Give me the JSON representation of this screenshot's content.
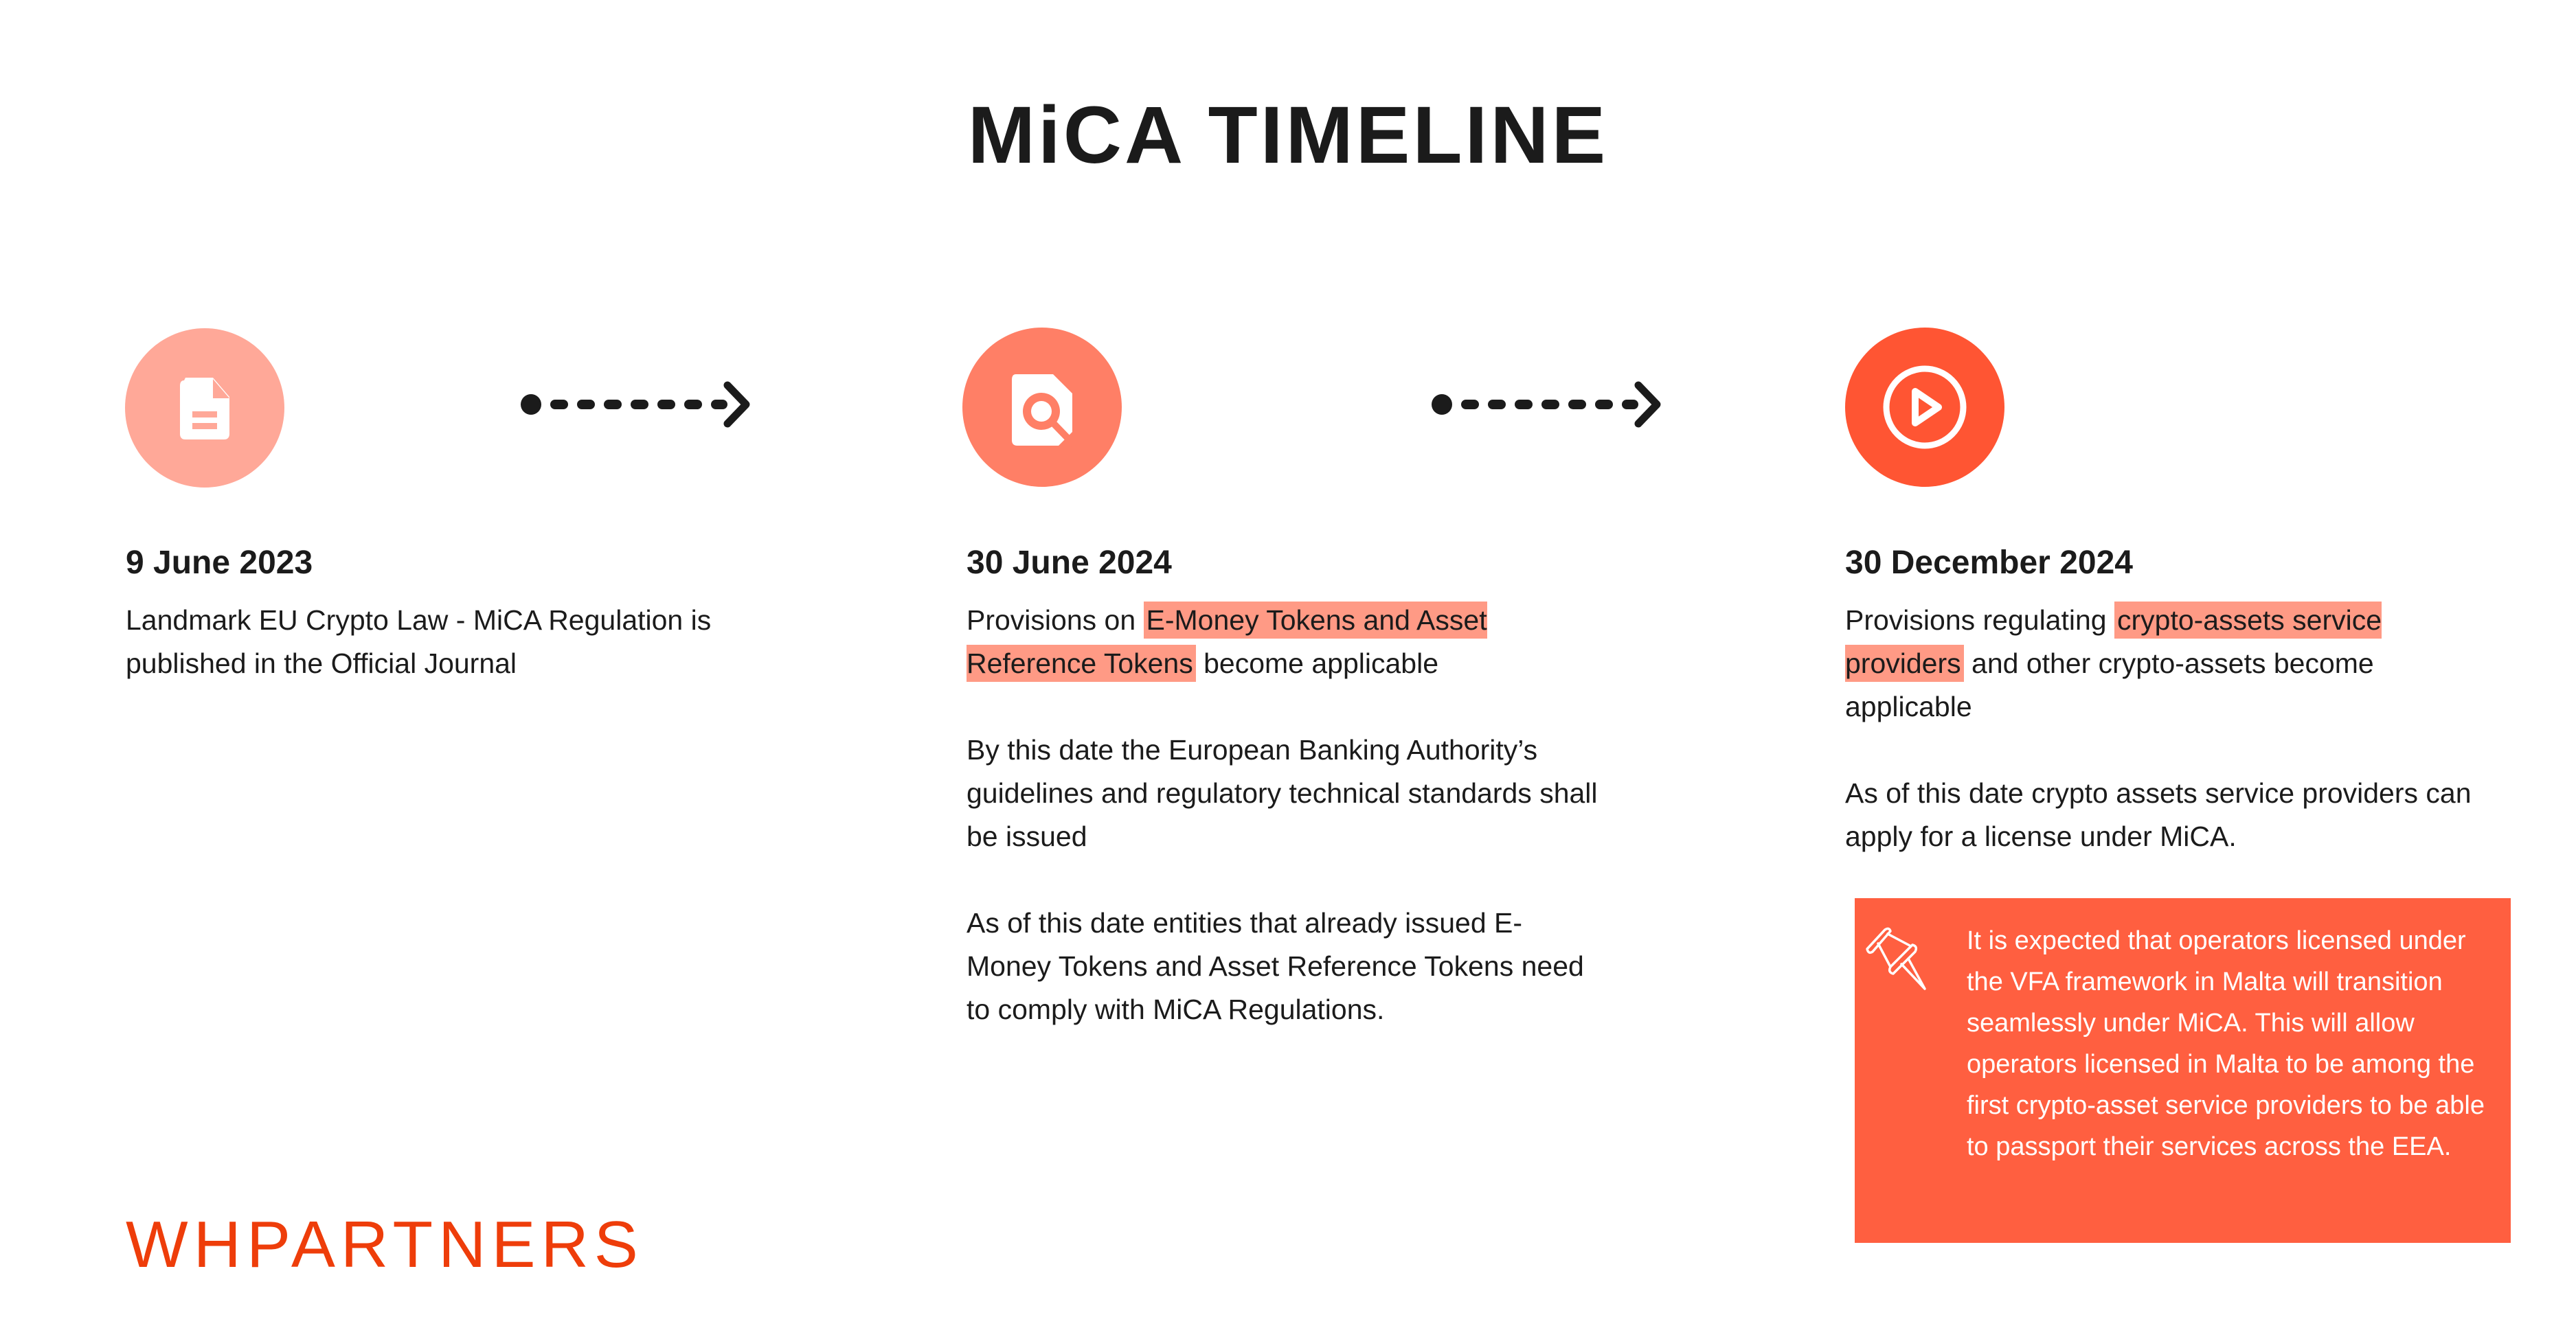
{
  "title": "MiCA TIMELINE",
  "colors": {
    "step1": "#FFA898",
    "step2": "#FF7F66",
    "step3": "#FF5533",
    "highlight": "#FF9A85",
    "note_bg": "#FF5F40",
    "brand": "#EE3D0A",
    "text": "#1B1B1B"
  },
  "steps": [
    {
      "icon": "document-icon",
      "date": "9 June 2023",
      "paragraphs": [
        {
          "before": "Landmark EU Crypto Law - MiCA Regulation is published in the Official Journal",
          "highlight": "",
          "after": ""
        }
      ]
    },
    {
      "icon": "document-search-icon",
      "date": "30 June 2024",
      "paragraphs": [
        {
          "before": "Provisions on ",
          "highlight": "E-Money Tokens and Asset Reference Tokens",
          "after": " become applicable"
        },
        {
          "before": "By this date the European Banking Authority’s guidelines and regulatory technical standards shall be issued",
          "highlight": "",
          "after": ""
        },
        {
          "before": "As of this date entities that already issued E-Money Tokens and Asset Reference Tokens need to comply with MiCA Regulations.",
          "highlight": "",
          "after": ""
        }
      ]
    },
    {
      "icon": "play-circle-icon",
      "date": "30 December 2024",
      "paragraphs": [
        {
          "before": "Provisions regulating ",
          "highlight": "crypto-assets service providers",
          "after": " and other crypto-assets become applicable"
        },
        {
          "before": "As of this date crypto assets service providers can apply for a license under MiCA.",
          "highlight": "",
          "after": ""
        }
      ]
    }
  ],
  "note": {
    "icon": "pushpin-icon",
    "text": "It is expected that operators licensed under the VFA framework in Malta will transition seamlessly under MiCA. This will allow operators licensed in Malta to be among the first crypto-asset service providers to be able to passport their services across the EEA."
  },
  "logo": "WHPARTNERS"
}
